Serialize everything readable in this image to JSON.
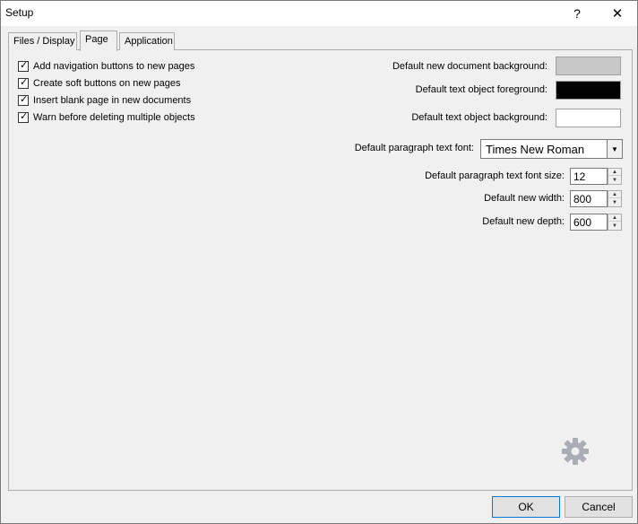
{
  "window": {
    "title": "Setup",
    "help_glyph": "?",
    "close_glyph": "✕"
  },
  "tabs": [
    {
      "label": "Files / Display",
      "active": false
    },
    {
      "label": "Page",
      "active": true
    },
    {
      "label": "Application",
      "active": false
    }
  ],
  "checkboxes": [
    {
      "label": "Add navigation buttons to new pages",
      "checked": true
    },
    {
      "label": "Create soft buttons on new pages",
      "checked": true
    },
    {
      "label": "Insert blank page in new documents",
      "checked": true
    },
    {
      "label": "Warn before deleting multiple objects",
      "checked": true
    }
  ],
  "check_glyph": "✓",
  "colors": {
    "doc_background_label": "Default new document background:",
    "doc_background_color": "#c8c8c8",
    "text_fg_label": "Default text object foreground:",
    "text_fg_color": "#000000",
    "text_bg_label": "Default text object background:",
    "text_bg_color": "#ffffff"
  },
  "font": {
    "label": "Default paragraph text font:",
    "selected": "Times New Roman",
    "arrow_glyph": "▼"
  },
  "spinners": {
    "font_size_label": "Default paragraph text font size:",
    "font_size": "12",
    "width_label": "Default new width:",
    "width": "800",
    "depth_label": "Default new depth:",
    "depth": "600",
    "up_glyph": "▲",
    "down_glyph": "▼"
  },
  "footer": {
    "ok_label": "OK",
    "cancel_label": "Cancel"
  },
  "icons": {
    "gear": "gear-icon"
  }
}
